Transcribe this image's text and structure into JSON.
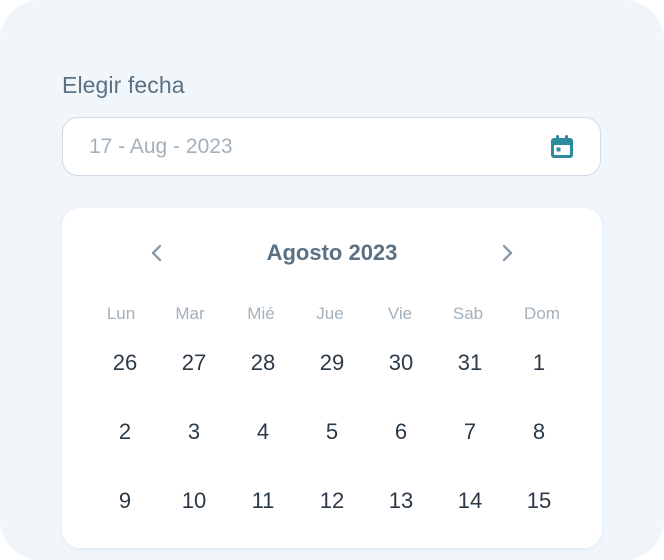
{
  "picker": {
    "label": "Elegir fecha",
    "placeholder": "17 - Aug - 2023",
    "calendar_icon": "calendar-icon"
  },
  "calendar": {
    "month_title": "Agosto 2023",
    "prev_icon": "chevron-left-icon",
    "next_icon": "chevron-right-icon",
    "weekdays": [
      "Lun",
      "Mar",
      "Mié",
      "Jue",
      "Vie",
      "Sab",
      "Dom"
    ],
    "weeks": [
      [
        "26",
        "27",
        "28",
        "29",
        "30",
        "31",
        "1"
      ],
      [
        "2",
        "3",
        "4",
        "5",
        "6",
        "7",
        "8"
      ],
      [
        "9",
        "10",
        "11",
        "12",
        "13",
        "14",
        "15"
      ]
    ]
  },
  "colors": {
    "background": "#f1f6fb",
    "accent": "#2e8a9d",
    "label_text": "#5b7184",
    "muted_text": "#a3b1bd",
    "day_text": "#2c3a47"
  }
}
